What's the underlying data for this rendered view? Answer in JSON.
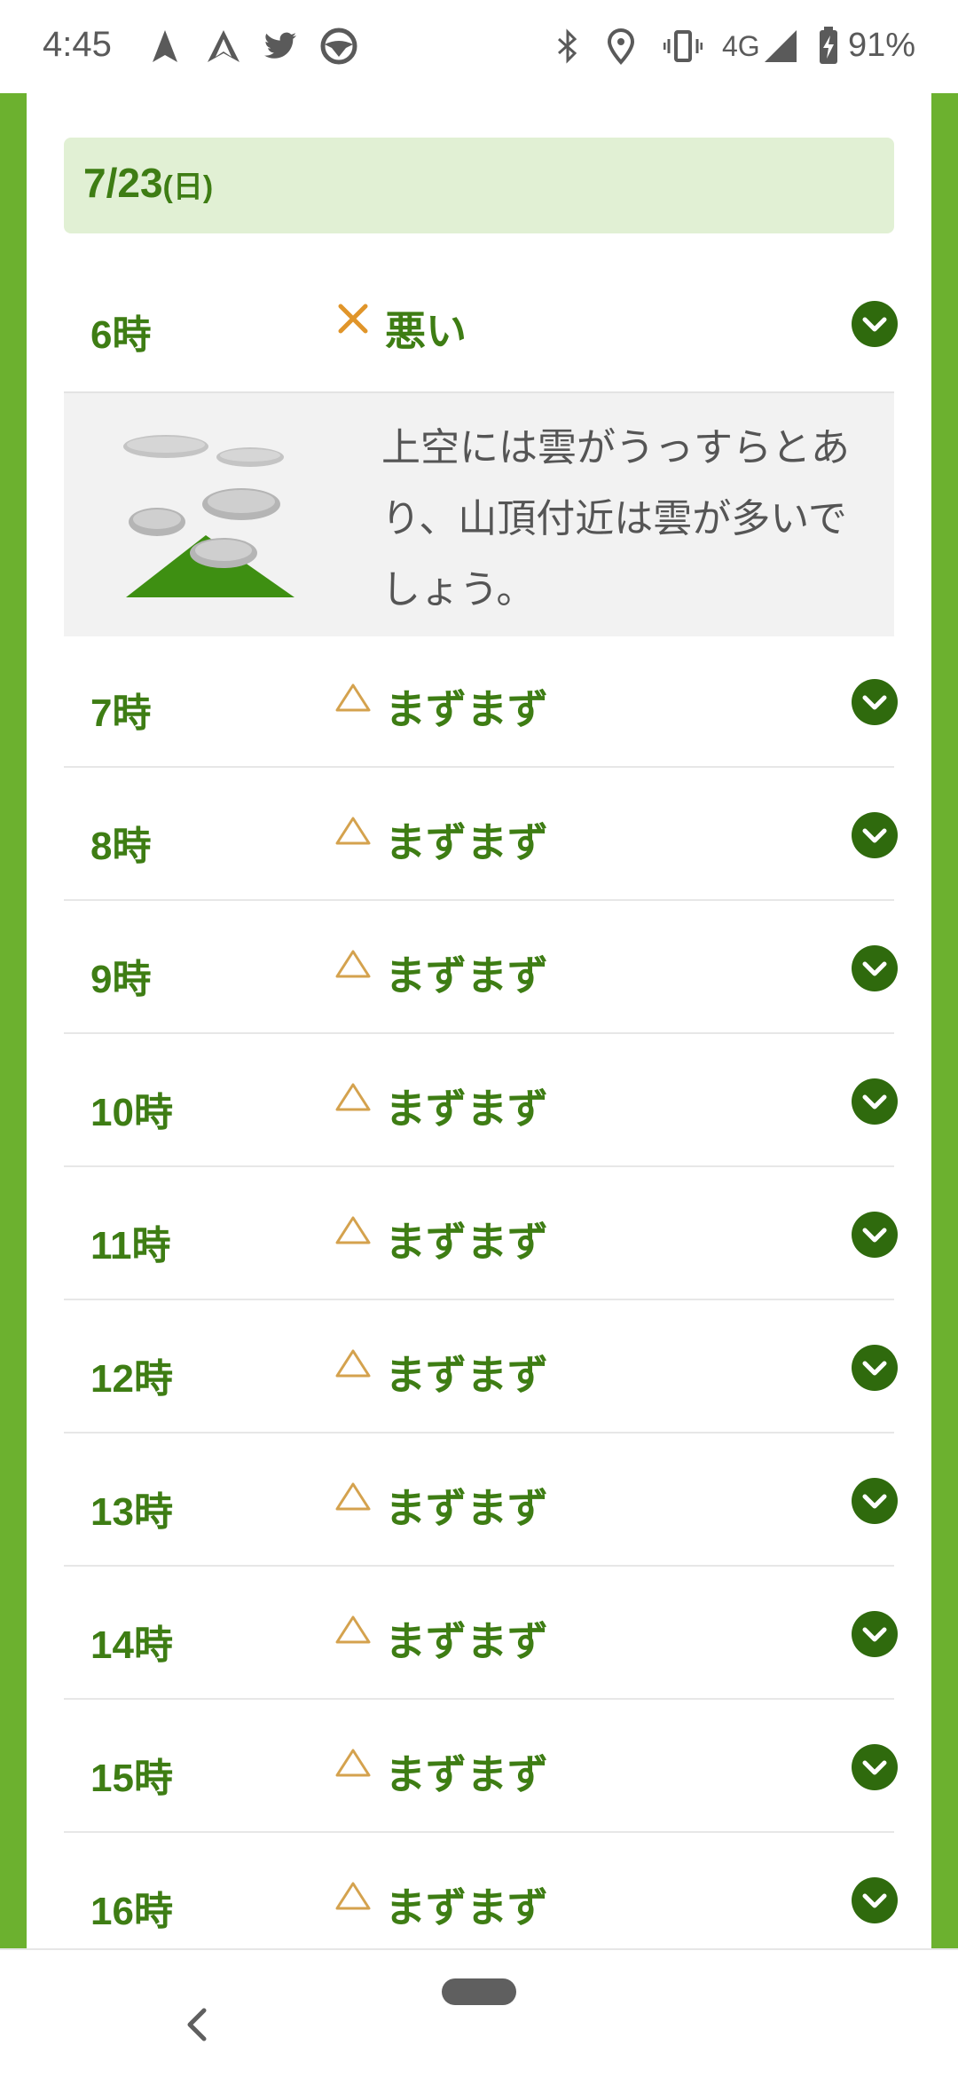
{
  "status_bar": {
    "time": "4:45",
    "network": "4G",
    "battery": "91%",
    "left_icons": [
      "navigation-arrow-icon",
      "double-arrow-icon",
      "twitter-icon",
      "steering-wheel-icon"
    ],
    "right_icons": [
      "bluetooth-icon",
      "location-icon",
      "vibrate-icon",
      "signal-icon",
      "battery-charging-icon"
    ]
  },
  "colors": {
    "frame_green": "#6cb12f",
    "text_green": "#3e7d14",
    "date_bg": "#e1f0d4",
    "button_green": "#2f6a0d",
    "cross_orange": "#e0952a",
    "triangle_tan": "#d4a24e"
  },
  "date": {
    "label": "7/23",
    "dow": "(日)"
  },
  "detail": {
    "text": "上空には雲がうっすらとあり、山頂付近は雲が多いでしょう。",
    "image_icon": "mountain-cloud-icon"
  },
  "rows": [
    {
      "hour": "6時",
      "mark": "×",
      "condition": "悪い"
    },
    {
      "hour": "7時",
      "mark": "△",
      "condition": "まずまず"
    },
    {
      "hour": "8時",
      "mark": "△",
      "condition": "まずまず"
    },
    {
      "hour": "9時",
      "mark": "△",
      "condition": "まずまず"
    },
    {
      "hour": "10時",
      "mark": "△",
      "condition": "まずまず"
    },
    {
      "hour": "11時",
      "mark": "△",
      "condition": "まずまず"
    },
    {
      "hour": "12時",
      "mark": "△",
      "condition": "まずまず"
    },
    {
      "hour": "13時",
      "mark": "△",
      "condition": "まずまず"
    },
    {
      "hour": "14時",
      "mark": "△",
      "condition": "まずまず"
    },
    {
      "hour": "15時",
      "mark": "△",
      "condition": "まずまず"
    },
    {
      "hour": "16時",
      "mark": "△",
      "condition": "まずまず"
    }
  ],
  "nav": {
    "back_icon": "chevron-left-icon",
    "home_icon": "home-pill-icon"
  }
}
